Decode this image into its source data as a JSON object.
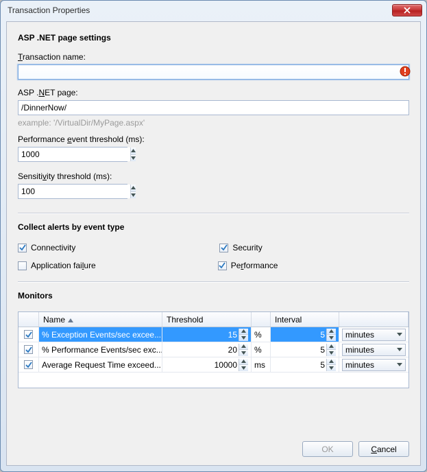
{
  "window": {
    "title": "Transaction Properties"
  },
  "section1": {
    "heading": "ASP .NET page settings",
    "transaction_name_label": "Transaction name:",
    "transaction_name_value": "",
    "asp_page_label": "ASP .NET page:",
    "asp_page_value": "/DinnerNow/",
    "asp_page_hint": "example: '/VirtualDir/MyPage.aspx'",
    "perf_threshold_label": "Performance event threshold (ms):",
    "perf_threshold_value": "1000",
    "sens_threshold_label": "Sensitivity threshold (ms):",
    "sens_threshold_value": "100"
  },
  "section2": {
    "heading": "Collect alerts by event type",
    "connectivity_label": "Connectivity",
    "connectivity_checked": true,
    "security_label": "Security",
    "security_checked": true,
    "appfailure_label": "Application failure",
    "appfailure_checked": false,
    "performance_label": "Performance",
    "performance_checked": true
  },
  "monitors": {
    "heading": "Monitors",
    "col_name": "Name",
    "col_threshold": "Threshold",
    "col_interval": "Interval",
    "rows": [
      {
        "checked": true,
        "selected": true,
        "name": "% Exception Events/sec excee...",
        "threshold": "15",
        "unit": "%",
        "interval": "5",
        "interval_unit": "minutes"
      },
      {
        "checked": true,
        "selected": false,
        "name": "% Performance Events/sec exc...",
        "threshold": "20",
        "unit": "%",
        "interval": "5",
        "interval_unit": "minutes"
      },
      {
        "checked": true,
        "selected": false,
        "name": "Average Request Time exceed...",
        "threshold": "10000",
        "unit": "ms",
        "interval": "5",
        "interval_unit": "minutes"
      }
    ]
  },
  "buttons": {
    "ok": "OK",
    "cancel": "Cancel"
  }
}
